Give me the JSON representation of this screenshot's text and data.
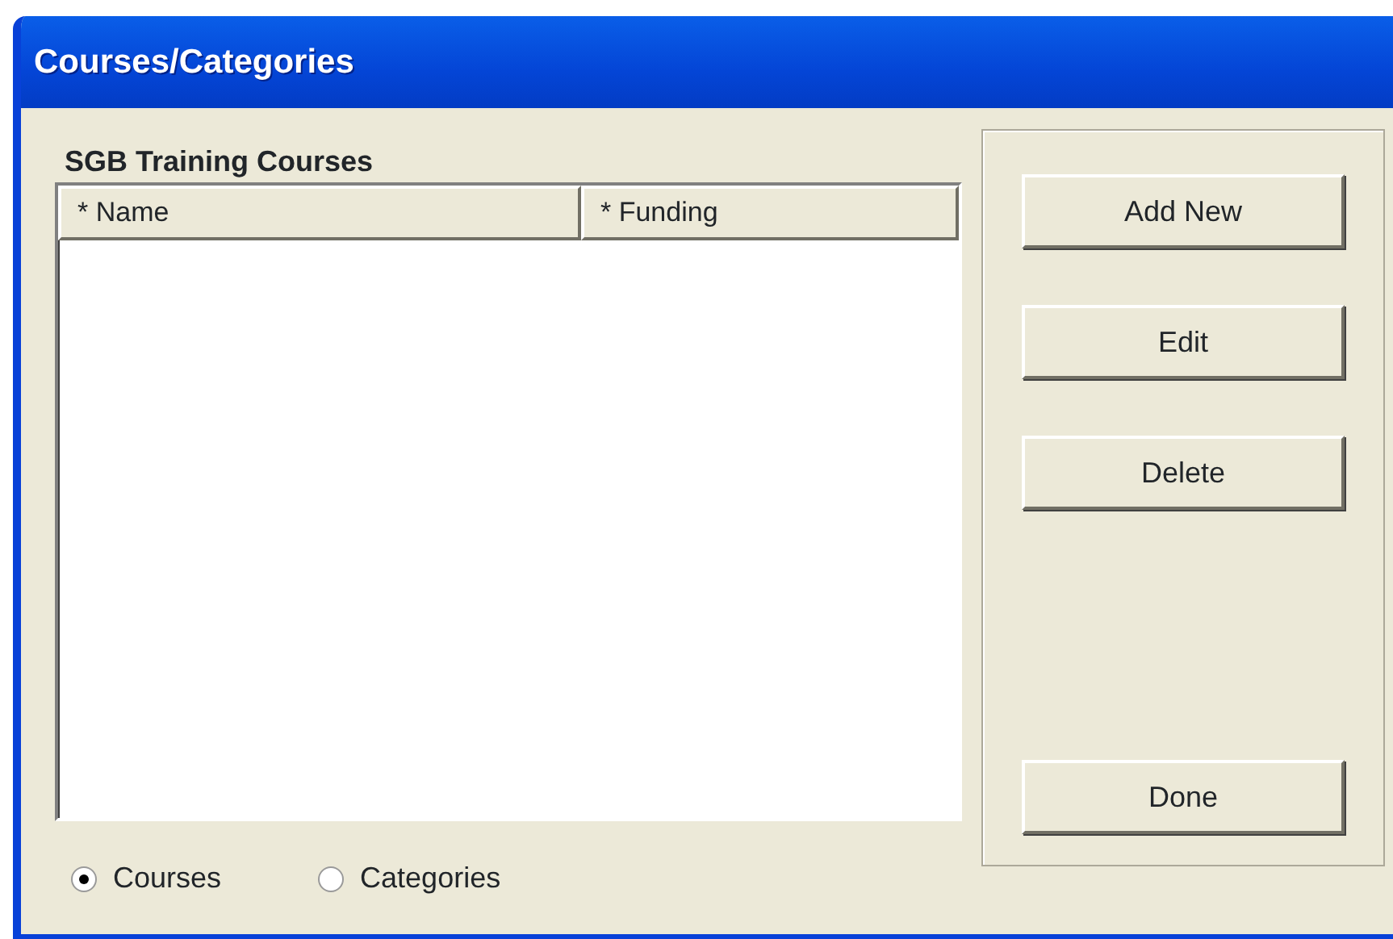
{
  "window": {
    "title": "Courses/Categories"
  },
  "group_label": "SGB Training Courses",
  "table": {
    "columns": [
      "* Name",
      "* Funding"
    ]
  },
  "view_options": [
    {
      "label": "Courses",
      "selected": true
    },
    {
      "label": "Categories",
      "selected": false
    }
  ],
  "buttons": [
    {
      "label": "Add New",
      "kind": "top"
    },
    {
      "label": "Edit",
      "kind": "top"
    },
    {
      "label": "Delete",
      "kind": "top"
    },
    {
      "label": "Done",
      "kind": "bottom"
    }
  ]
}
